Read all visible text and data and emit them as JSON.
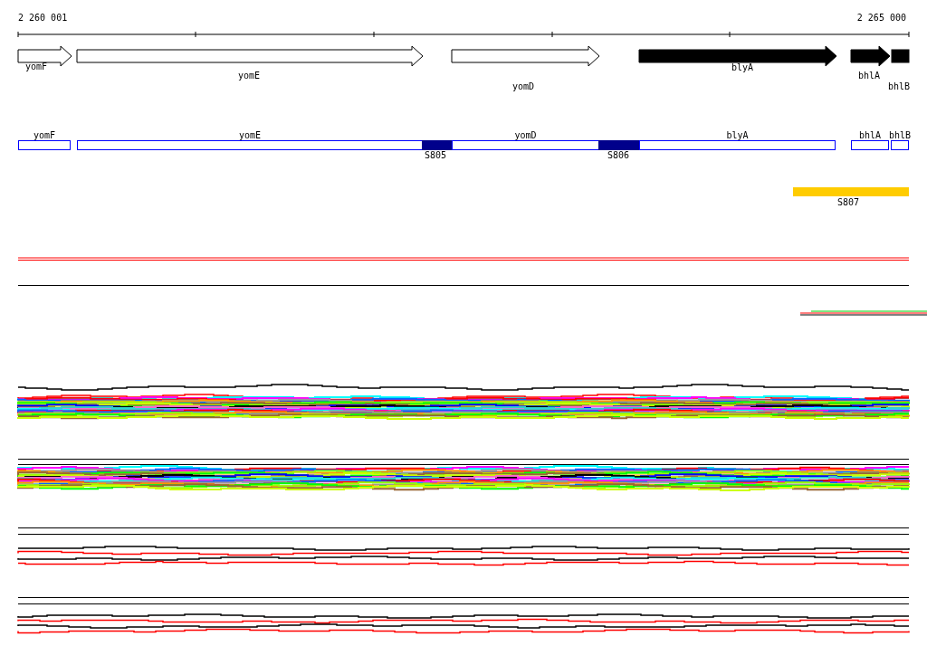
{
  "ruler": {
    "start_label": "2 260 001",
    "end_label": "2 265 000"
  },
  "genes": [
    {
      "name": "yomF",
      "kind": "arrow",
      "filled": false
    },
    {
      "name": "yomE",
      "kind": "arrow",
      "filled": false
    },
    {
      "name": "yomD",
      "kind": "arrow",
      "filled": false
    },
    {
      "name": "blyA",
      "kind": "arrow",
      "filled": true
    },
    {
      "name": "bhlA",
      "kind": "arrow",
      "filled": true
    },
    {
      "name": "bhlB",
      "kind": "truncated",
      "filled": true
    }
  ],
  "gene_boxes": [
    {
      "name": "yomF"
    },
    {
      "name": "yomE"
    },
    {
      "name": "yomD"
    },
    {
      "name": "blyA"
    },
    {
      "name": "bhlA"
    },
    {
      "name": "bhlB"
    }
  ],
  "regions": [
    {
      "name": "S805",
      "color": "#00008b"
    },
    {
      "name": "S806",
      "color": "#00008b"
    },
    {
      "name": "S807",
      "color": "#ffcc00"
    }
  ]
}
